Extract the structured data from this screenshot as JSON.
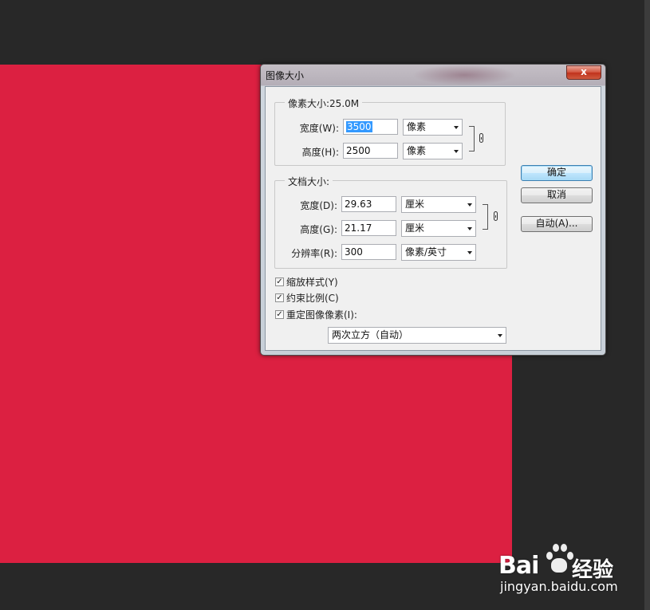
{
  "dialog": {
    "title": "图像大小",
    "close_label": "x"
  },
  "pixel_dimensions": {
    "legend": "像素大小:25.0M",
    "width": {
      "label": "宽度(W):",
      "value": "3500",
      "unit": "像素"
    },
    "height": {
      "label": "高度(H):",
      "value": "2500",
      "unit": "像素"
    }
  },
  "document_size": {
    "legend": "文档大小:",
    "width": {
      "label": "宽度(D):",
      "value": "29.63",
      "unit": "厘米"
    },
    "height": {
      "label": "高度(G):",
      "value": "21.17",
      "unit": "厘米"
    },
    "resolution": {
      "label": "分辨率(R):",
      "value": "300",
      "unit": "像素/英寸"
    }
  },
  "options": {
    "scale_styles": {
      "label": "缩放样式(Y)",
      "checked": true
    },
    "constrain_proportions": {
      "label": "约束比例(C)",
      "checked": true
    },
    "resample": {
      "label": "重定图像像素(I):",
      "checked": true
    },
    "resample_method": "两次立方（自动）"
  },
  "buttons": {
    "ok": "确定",
    "cancel": "取消",
    "auto": "自动(A)..."
  },
  "watermark": {
    "logo_text": "Bai",
    "logo_text2": "经验",
    "url": "jingyan.baidu.com"
  },
  "colors": {
    "canvas_document": "#dc2041",
    "workspace": "#282828",
    "dialog_face": "#f0f0f0",
    "selection": "#3399ff"
  }
}
